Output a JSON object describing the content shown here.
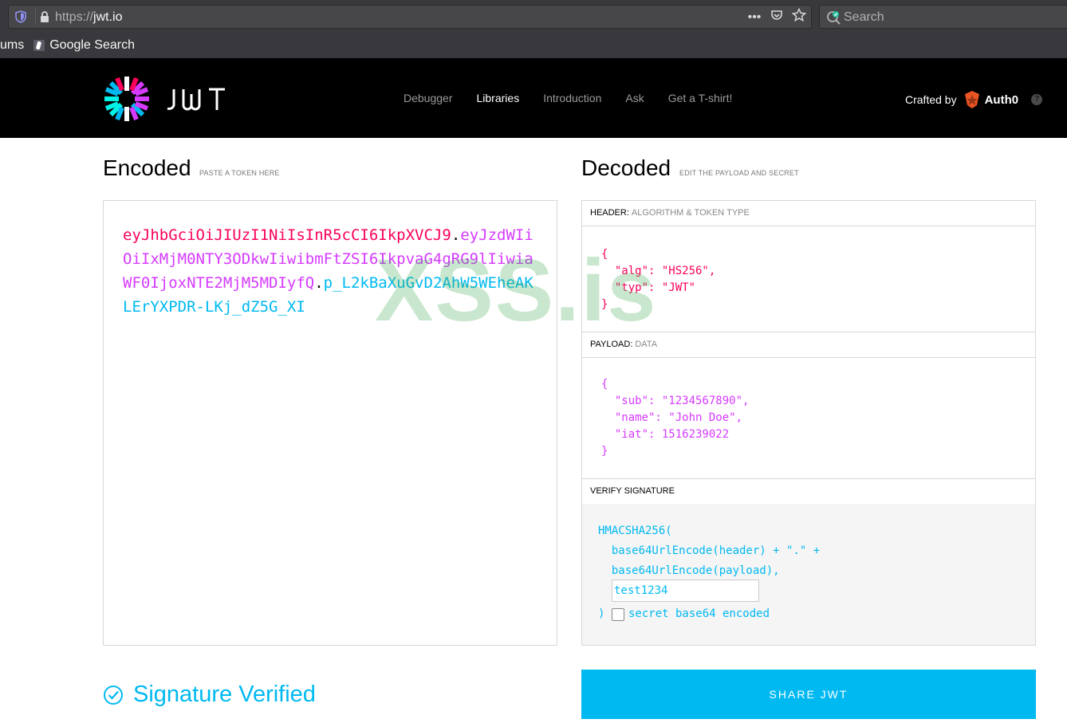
{
  "browser": {
    "url_proto": "https://",
    "url_host": "jwt.io",
    "search_placeholder": "Search",
    "bookmarks": [
      {
        "label": "ums"
      },
      {
        "label": "Google Search"
      }
    ]
  },
  "header": {
    "logo_text": "JWT",
    "nav": [
      {
        "label": "Debugger",
        "active": false
      },
      {
        "label": "Libraries",
        "active": true
      },
      {
        "label": "Introduction",
        "active": false
      },
      {
        "label": "Ask",
        "active": false
      },
      {
        "label": "Get a T-shirt!",
        "active": false
      }
    ],
    "crafted_by": "Crafted by",
    "brand": "Auth0",
    "help": "?"
  },
  "encoded": {
    "title": "Encoded",
    "subtitle": "PASTE A TOKEN HERE",
    "token_header": "eyJhbGciOiJIUzI1NiIsInR5cCI6IkpXVCJ9",
    "token_payload": "eyJzdWIiOiIxMjM0NTY3ODkwIiwibmFtZSI6IkpvaG4gRG9lIiwiaWF0IjoxNTE2MjM5MDIyfQ",
    "token_signature": "p_L2kBaXuGvD2AhW5WEheAKLErYXPDR-LKj_dZ5G_XI",
    "dot": "."
  },
  "decoded": {
    "title": "Decoded",
    "subtitle": "EDIT THE PAYLOAD AND SECRET",
    "header_section": {
      "label": "HEADER:",
      "sub": "ALGORITHM & TOKEN TYPE"
    },
    "header_json": "{\n  \"alg\": \"HS256\",\n  \"typ\": \"JWT\"\n}",
    "payload_section": {
      "label": "PAYLOAD:",
      "sub": "DATA"
    },
    "payload_json": "{\n  \"sub\": \"1234567890\",\n  \"name\": \"John Doe\",\n  \"iat\": 1516239022\n}",
    "verify_section": {
      "label": "VERIFY SIGNATURE"
    },
    "verify_code": "HMACSHA256(\n  base64UrlEncode(header) + \".\" +\n  base64UrlEncode(payload),",
    "secret_value": "test1234",
    "close_paren": ")",
    "base64_label": "secret base64 encoded"
  },
  "footer": {
    "verified_text": "Signature Verified",
    "share_label": "SHARE JWT"
  },
  "watermark": "XSS.is",
  "colors": {
    "header": "#fb015b",
    "payload": "#d63aff",
    "signature": "#00b9f1"
  }
}
